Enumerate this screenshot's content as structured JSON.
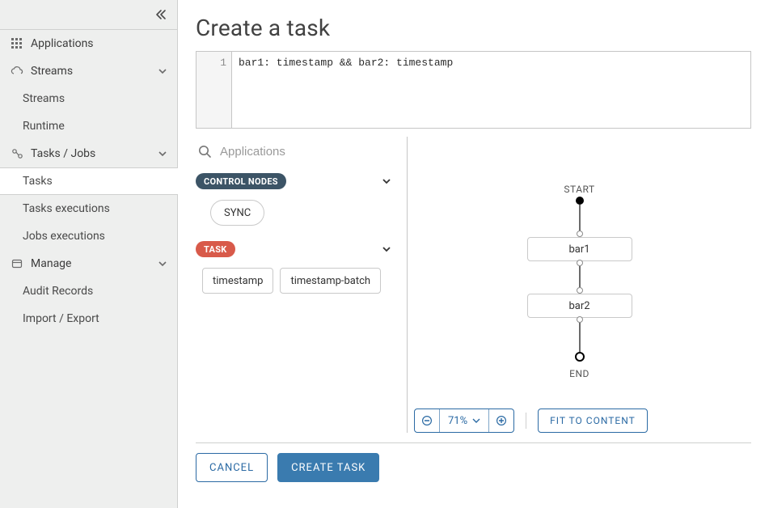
{
  "sidebar": {
    "applications_label": "Applications",
    "groups": {
      "streams": {
        "label": "Streams",
        "items": [
          "Streams",
          "Runtime"
        ]
      },
      "tasks": {
        "label": "Tasks / Jobs",
        "items": [
          "Tasks",
          "Tasks executions",
          "Jobs executions"
        ],
        "active_index": 0
      },
      "manage": {
        "label": "Manage",
        "items": [
          "Audit Records",
          "Import / Export"
        ]
      }
    }
  },
  "page": {
    "title": "Create a task"
  },
  "editor": {
    "line_number": "1",
    "content": "bar1: timestamp && bar2: timestamp"
  },
  "palette": {
    "search_placeholder": "Applications",
    "sections": {
      "control_nodes": {
        "label": "CONTROL NODES",
        "items": [
          "SYNC"
        ]
      },
      "task": {
        "label": "TASK",
        "items": [
          "timestamp",
          "timestamp-batch"
        ]
      }
    }
  },
  "graph": {
    "start_label": "START",
    "end_label": "END",
    "nodes": [
      "bar1",
      "bar2"
    ]
  },
  "zoom": {
    "value": "71%"
  },
  "buttons": {
    "fit": "FIT TO CONTENT",
    "cancel": "CANCEL",
    "create": "CREATE TASK"
  }
}
